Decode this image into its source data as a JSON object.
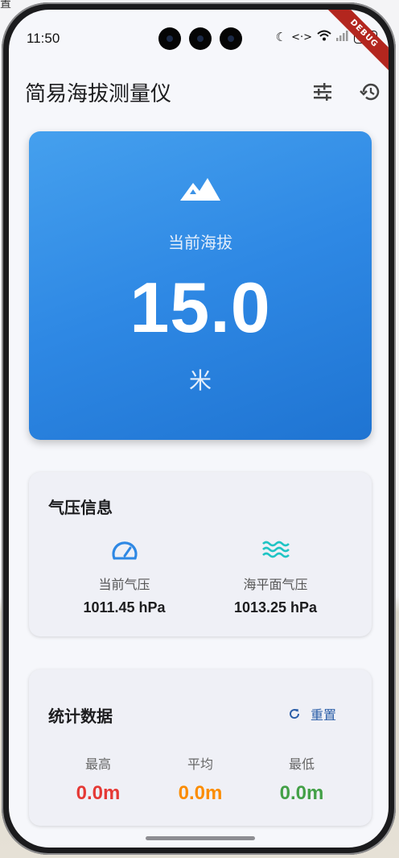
{
  "status_bar": {
    "time": "11:50",
    "battery": "100"
  },
  "debug_banner": "DEBUG",
  "app": {
    "title": "简易海拔测量仪"
  },
  "altitude": {
    "label": "当前海拔",
    "value": "15.0",
    "unit": "米"
  },
  "pressure_card": {
    "title": "气压信息",
    "current": {
      "label": "当前气压",
      "value": "1011.45 hPa"
    },
    "sea_level": {
      "label": "海平面气压",
      "value": "1013.25 hPa"
    }
  },
  "stats_card": {
    "title": "统计数据",
    "reset_label": "重置",
    "items": [
      {
        "label": "最高",
        "value": "0.0m",
        "color": "#e53935"
      },
      {
        "label": "平均",
        "value": "0.0m",
        "color": "#fb8c00"
      },
      {
        "label": "最低",
        "value": "0.0m",
        "color": "#43a047"
      }
    ]
  },
  "colors": {
    "primary": "#2e88e4",
    "accent_teal": "#1fc4c4",
    "reset": "#2b5ea8"
  },
  "icons": [
    "moon-icon",
    "data-transfer-icon",
    "wifi-icon",
    "signal-icon",
    "tune-icon",
    "history-icon",
    "mountain-icon",
    "speedometer-icon",
    "waves-icon",
    "refresh-icon"
  ]
}
